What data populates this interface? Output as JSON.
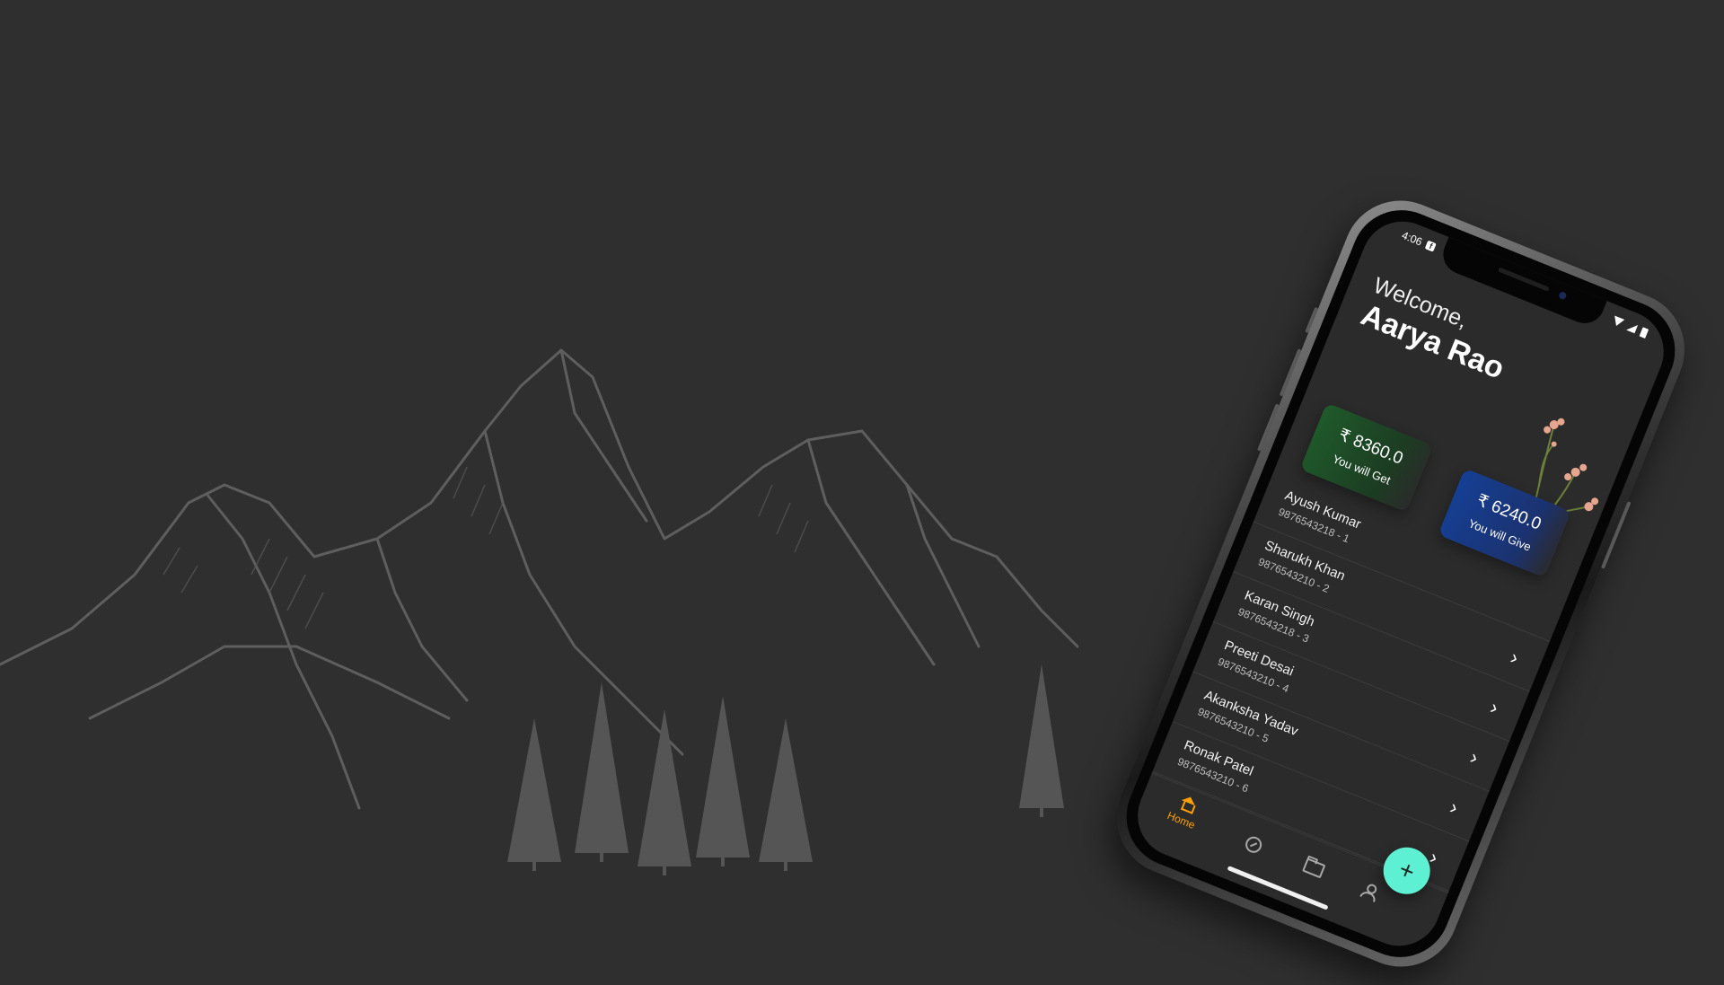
{
  "status_bar": {
    "time": "4:06",
    "fb_glyph": "f"
  },
  "header": {
    "greeting": "Welcome,",
    "user_name": "Aarya Rao"
  },
  "summary": {
    "get": {
      "amount": "₹ 8360.0",
      "label": "You will Get",
      "color": "#1f5a2a"
    },
    "give": {
      "amount": "₹ 6240.0",
      "label": "You will Give",
      "color": "#153f94"
    }
  },
  "contacts": [
    {
      "name": "Ayush Kumar",
      "phone": "9876543218 - 1"
    },
    {
      "name": "Sharukh Khan",
      "phone": "9876543210 - 2"
    },
    {
      "name": "Karan Singh",
      "phone": "9876543218 - 3"
    },
    {
      "name": "Preeti Desai",
      "phone": "9876543210 - 4"
    },
    {
      "name": "Akanksha Yadav",
      "phone": "9876543210 - 5"
    },
    {
      "name": "Ronak Patel",
      "phone": "9876543210 - 6"
    }
  ],
  "icons": {
    "row_action": "chevron-right-icon",
    "fab": "plus-icon",
    "chevron_glyph": "›",
    "fab_glyph": "+"
  },
  "nav": {
    "home_label": "Home",
    "items": [
      "home-icon",
      "compass-icon",
      "folder-icon",
      "person-icon"
    ],
    "active_color": "#ff9f0a"
  },
  "colors": {
    "background": "#2f2f2f",
    "fab": "#5ef0d2"
  }
}
